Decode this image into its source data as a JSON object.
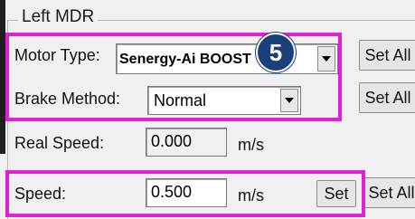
{
  "group": {
    "title": "Left MDR"
  },
  "motor_type": {
    "label": "Motor Type:",
    "value": "Senergy-Ai BOOST",
    "set_all_label": "Set All"
  },
  "brake_method": {
    "label": "Brake Method:",
    "value": "Normal",
    "set_all_label": "Set All"
  },
  "real_speed": {
    "label": "Real Speed:",
    "value": "0.000",
    "unit": "m/s"
  },
  "speed": {
    "label": "Speed:",
    "value": "0.500",
    "unit": "m/s",
    "set_label": "Set",
    "set_all_label": "Set All"
  },
  "annotation": {
    "step_number": "5",
    "highlight_color": "#e21fd4",
    "badge_color": "#1b3f7a"
  }
}
